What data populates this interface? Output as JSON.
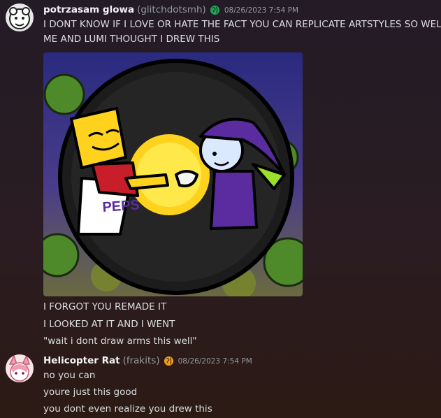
{
  "messages": [
    {
      "username": "potrzasam glowa",
      "handle": "(glitchdotsmh)",
      "badge_icon": "globe-icon",
      "timestamp": "08/26/2023 7:54 PM",
      "lines": [
        "I DONT KNOW IF I LOVE OR HATE THE FACT YOU CAN REPLICATE ARTSTYLES SO WELL",
        "ME AND LUMI THOUGHT I DREW THIS"
      ],
      "attachment": {
        "type": "image",
        "label": "PEPS",
        "colors": {
          "background": "#2e2e7c",
          "circle": "#1c1c1c",
          "yellow": "#ffd21e",
          "red": "#c81e2a",
          "purple": "#5a2ca0"
        }
      },
      "after_lines": [
        "I FORGOT YOU REMADE IT",
        "I LOOKED AT IT AND I WENT",
        "\"wait i dont draw arms this well\""
      ]
    },
    {
      "username": "Helicopter Rat",
      "handle": "(frakits)",
      "badge_icon": "globe-icon",
      "timestamp": "08/26/2023 7:54 PM",
      "lines": [
        "no you can",
        "youre just this good",
        "you dont even realize you drew this"
      ]
    }
  ],
  "colors": {
    "globe_green": "#23a559",
    "globe_orange": "#f0a020"
  }
}
